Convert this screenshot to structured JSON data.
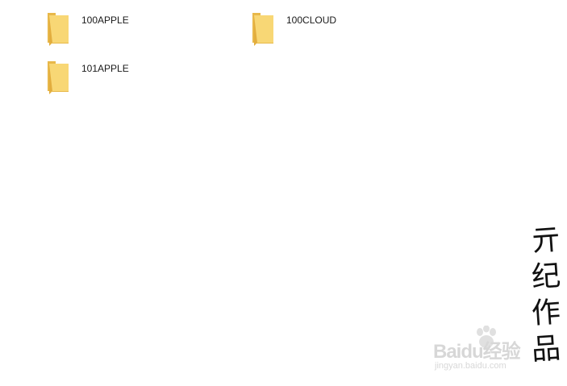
{
  "folders": [
    {
      "name": "100APPLE"
    },
    {
      "name": "100CLOUD"
    },
    {
      "name": "101APPLE"
    }
  ],
  "watermark": {
    "signature_chars": [
      "亓",
      "纪",
      "作",
      "品"
    ],
    "brand": "Baidu经验",
    "site": "jingyan.baidu.com"
  },
  "colors": {
    "folder_front": "#f8d775",
    "folder_back": "#e8b84a",
    "background": "#ffffff"
  }
}
